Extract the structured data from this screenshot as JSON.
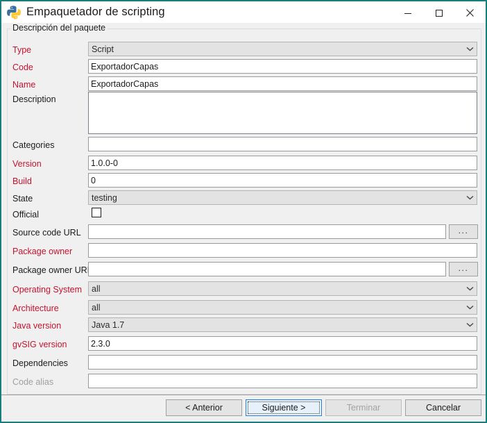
{
  "window": {
    "title": "Empaquetador de scripting",
    "icon": "python-logo-icon",
    "accent_color": "#197e7e",
    "required_label_color": "#c4122f",
    "controls": {
      "minimize": "minimize-icon",
      "maximize": "maximize-icon",
      "close": "close-icon"
    }
  },
  "group": {
    "legend": "Descripción del paquete"
  },
  "fields": {
    "type": {
      "label": "Type",
      "value": "Script",
      "required": true,
      "control": "combobox",
      "disabled": true
    },
    "code": {
      "label": "Code",
      "value": "ExportadorCapas",
      "required": true,
      "control": "text"
    },
    "name": {
      "label": "Name",
      "value": "ExportadorCapas",
      "required": true,
      "control": "text"
    },
    "description": {
      "label": "Description",
      "value": "",
      "required": false,
      "control": "textarea"
    },
    "categories": {
      "label": "Categories",
      "value": "",
      "required": false,
      "control": "text"
    },
    "version": {
      "label": "Version",
      "value": "1.0.0-0",
      "required": true,
      "control": "text"
    },
    "build": {
      "label": "Build",
      "value": "0",
      "required": true,
      "control": "text"
    },
    "state": {
      "label": "State",
      "value": "testing",
      "required": false,
      "control": "combobox",
      "disabled": true
    },
    "official": {
      "label": "Official",
      "checked": false,
      "required": false,
      "control": "checkbox"
    },
    "source_code_url": {
      "label": "Source code URL",
      "value": "",
      "required": false,
      "control": "text",
      "browse_label": "..."
    },
    "package_owner": {
      "label": "Package owner",
      "value": "",
      "required": true,
      "control": "text"
    },
    "package_owner_url": {
      "label": "Package owner URL",
      "value": "",
      "required": false,
      "control": "text",
      "browse_label": "..."
    },
    "operating_system": {
      "label": "Operating System",
      "value": "all",
      "required": true,
      "control": "combobox",
      "disabled": true
    },
    "architecture": {
      "label": "Architecture",
      "value": "all",
      "required": true,
      "control": "combobox",
      "disabled": true
    },
    "java_version": {
      "label": "Java version",
      "value": "Java 1.7",
      "required": true,
      "control": "combobox",
      "disabled": true
    },
    "gvsig_version": {
      "label": "gvSIG version",
      "value": "2.3.0",
      "required": true,
      "control": "text"
    },
    "dependencies": {
      "label": "Dependencies",
      "value": "",
      "required": false,
      "control": "text"
    },
    "code_alias": {
      "label": "Code alias",
      "value": "",
      "required": false,
      "control": "text",
      "disabled": true
    }
  },
  "buttons": {
    "previous": {
      "label": "< Anterior",
      "state": "enabled"
    },
    "next": {
      "label": "Siguiente >",
      "state": "focused"
    },
    "finish": {
      "label": "Terminar",
      "state": "disabled"
    },
    "cancel": {
      "label": "Cancelar",
      "state": "enabled"
    }
  }
}
